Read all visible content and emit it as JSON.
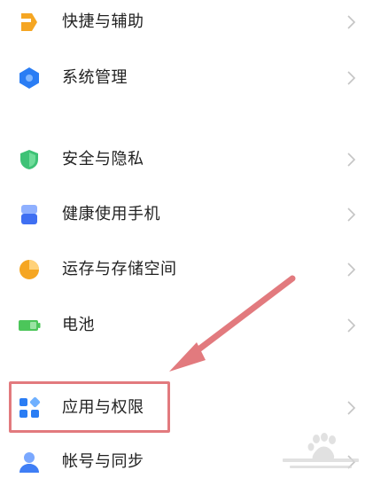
{
  "settings": {
    "items": [
      {
        "label": "快捷与辅助",
        "icon": "shortcut-icon",
        "color": "#f5a623"
      },
      {
        "label": "系统管理",
        "icon": "system-hexagon-icon",
        "color": "#2a7df4"
      },
      {
        "label": "安全与隐私",
        "icon": "shield-icon",
        "color": "#3ec276"
      },
      {
        "label": "健康使用手机",
        "icon": "hourglass-icon",
        "color": "#3f6ff2"
      },
      {
        "label": "运存与存储空间",
        "icon": "pie-chart-icon",
        "color": "#f5a623"
      },
      {
        "label": "电池",
        "icon": "battery-icon",
        "color": "#4cc65a"
      },
      {
        "label": "应用与权限",
        "icon": "apps-grid-icon",
        "color": "#2a7df4"
      },
      {
        "label": "帐号与同步",
        "icon": "person-icon",
        "color": "#3f7ef5"
      }
    ]
  },
  "annotation": {
    "color": "#e27a7e"
  },
  "colors": {
    "background": "#ffffff",
    "chevron": "#c4c4c4",
    "divider": "#efefef"
  }
}
